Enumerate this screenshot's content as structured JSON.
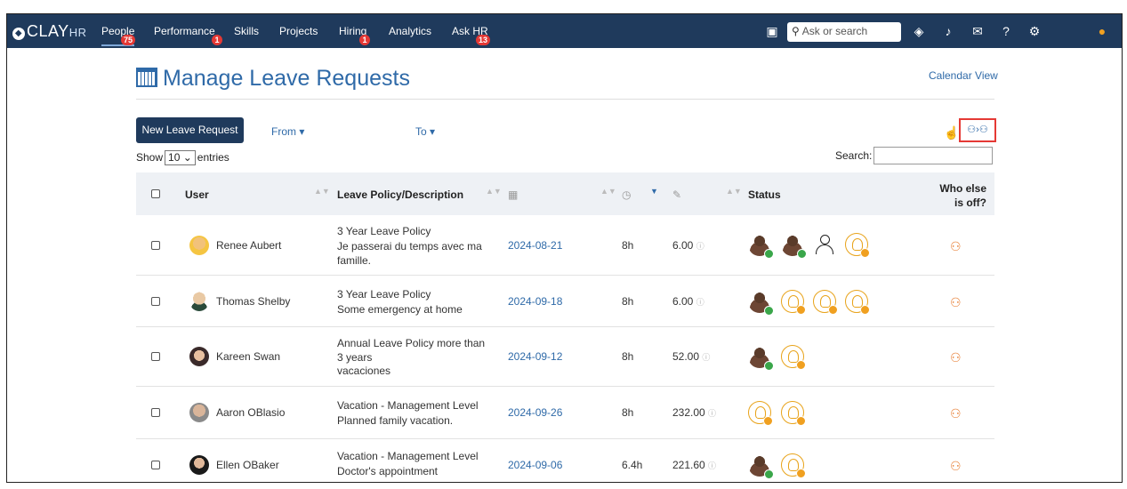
{
  "nav": {
    "logo": "CLAY",
    "logo_suffix": "HR",
    "items": [
      {
        "label": "People",
        "badge": "75",
        "active": true
      },
      {
        "label": "Performance",
        "badge": "1"
      },
      {
        "label": "Skills",
        "badge": ""
      },
      {
        "label": "Projects",
        "badge": ""
      },
      {
        "label": "Hiring",
        "badge": "1"
      },
      {
        "label": "Analytics",
        "badge": ""
      },
      {
        "label": "Ask HR",
        "badge": "13"
      }
    ],
    "search_placeholder": "Ask or search",
    "icons": [
      "inbox-icon",
      "layers-icon",
      "bell-icon",
      "mail-icon",
      "help-icon",
      "settings-icon",
      "user-avatar-icon"
    ]
  },
  "page": {
    "title": "Manage Leave Requests",
    "calendar_view": "Calendar View",
    "new_button": "New Leave Request",
    "from_filter": "From",
    "to_filter": "To",
    "show_label": "Show",
    "entries_value": "10",
    "entries_label": "entries",
    "search_label": "Search:"
  },
  "table": {
    "columns": [
      "User",
      "Leave Policy/Description",
      "Status",
      "Who else is off?"
    ],
    "rows": [
      {
        "user": "Renee Aubert",
        "policy": "3 Year Leave Policy",
        "desc": "Je passerai du temps avec ma famille.",
        "date": "2024-08-21",
        "hours": "8h",
        "balance": "6.00"
      },
      {
        "user": "Thomas Shelby",
        "policy": "3 Year Leave Policy",
        "desc": "Some emergency at home",
        "date": "2024-09-18",
        "hours": "8h",
        "balance": "6.00"
      },
      {
        "user": "Kareen Swan",
        "policy": "Annual Leave Policy more than 3 years",
        "desc": "vacaciones",
        "date": "2024-09-12",
        "hours": "8h",
        "balance": "52.00"
      },
      {
        "user": "Aaron OBlasio",
        "policy": "Vacation - Management Level",
        "desc": "Planned family vacation.",
        "date": "2024-09-26",
        "hours": "8h",
        "balance": "232.00"
      },
      {
        "user": "Ellen OBaker",
        "policy": "Vacation - Management Level",
        "desc": "Doctor's appointment",
        "date": "2024-09-06",
        "hours": "6.4h",
        "balance": "221.60"
      }
    ]
  },
  "colors": {
    "nav_bg": "#1f3a5c",
    "accent": "#2f6aa8",
    "approved": "#3aa64a",
    "pending": "#f0a020",
    "highlight": "#e53935"
  }
}
